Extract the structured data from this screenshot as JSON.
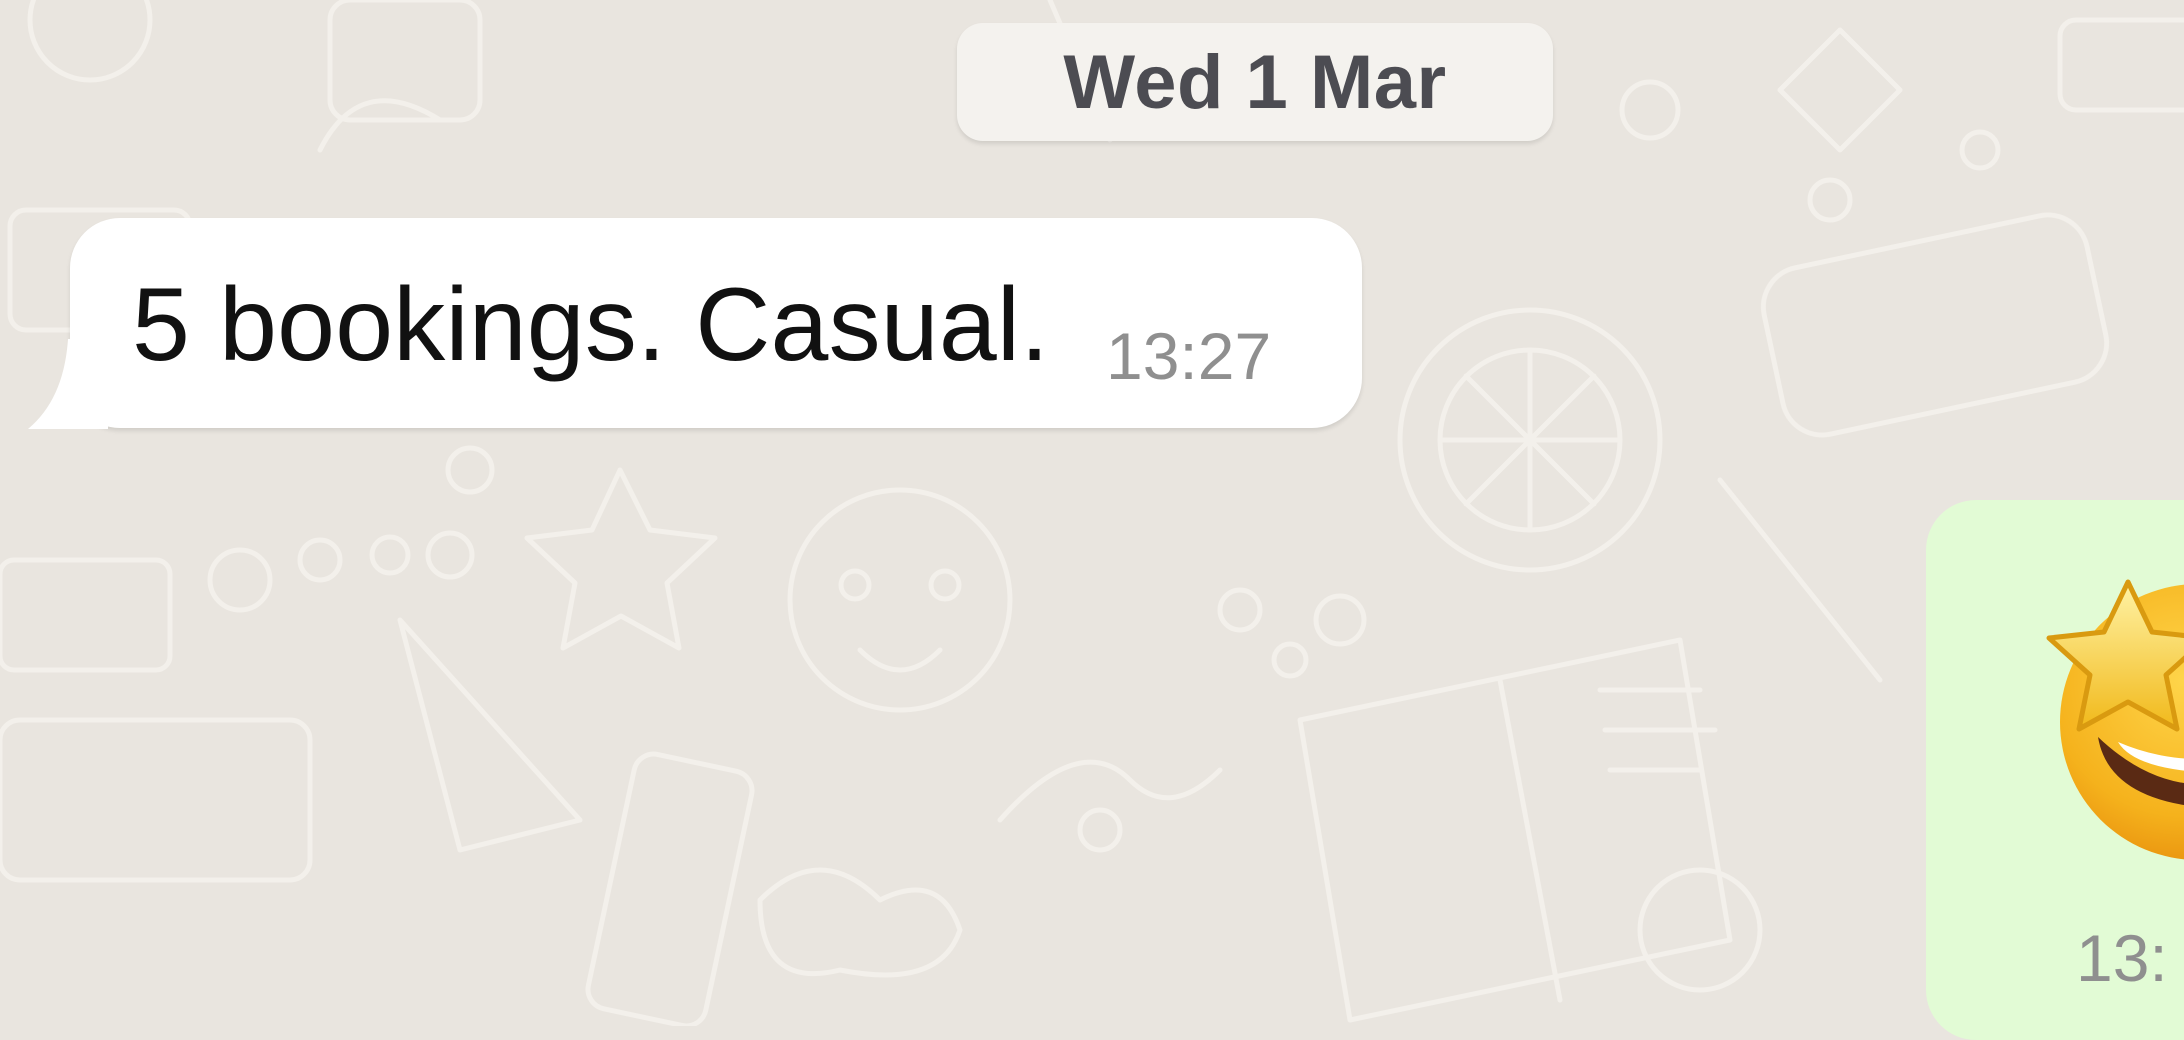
{
  "date_divider": "Wed 1 Mar",
  "messages": [
    {
      "direction": "incoming",
      "text": "5 bookings. Casual.",
      "time": "13:27"
    },
    {
      "direction": "outgoing",
      "emoji": "star-struck-emoji",
      "time": "13:"
    }
  ],
  "colors": {
    "background": "#e9e5df",
    "incoming_bubble": "#ffffff",
    "outgoing_bubble": "#e2fbd5",
    "date_chip": "#f4f2ee",
    "timestamp": "#8f8f8f"
  }
}
